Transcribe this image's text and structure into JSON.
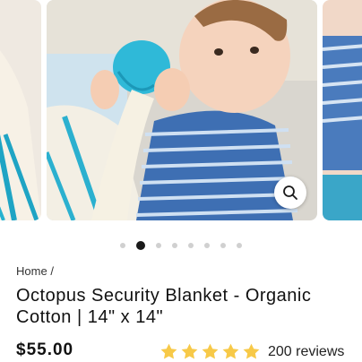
{
  "gallery": {
    "images": [
      {
        "icon": "blanket-photo"
      },
      {
        "icon": "baby-octopus-photo"
      },
      {
        "icon": "baby-striped-shirt-photo"
      }
    ],
    "zoom_icon": "magnifier-icon",
    "dot_count": 8,
    "active_dot_index": 1
  },
  "breadcrumb": {
    "home_label": "Home",
    "separator": "/"
  },
  "product": {
    "title": "Octopus Security Blanket - Organic Cotton | 14\" x 14\"",
    "price": "$55.00",
    "rating_value": 5,
    "rating_max": 5,
    "reviews_label": "200 reviews"
  },
  "colors": {
    "star": "#F7C948",
    "active_dot": "#1a1a1a",
    "inactive_dot": "#d0d0d0"
  }
}
